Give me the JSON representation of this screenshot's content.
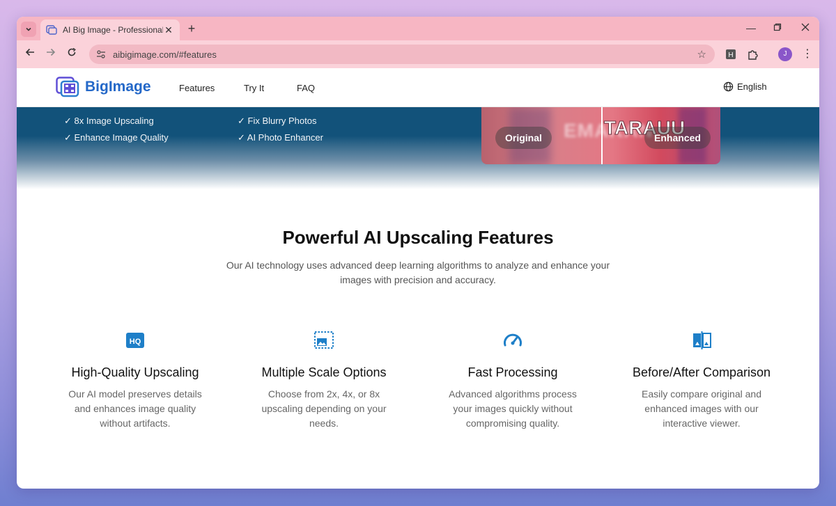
{
  "browser": {
    "tab_title": "AI Big Image - Professional Ima",
    "close_glyph": "✕",
    "new_tab_glyph": "+",
    "url": "aibigimage.com/#features",
    "extension_badge": "H",
    "profile_initial": "J",
    "icons": [
      "chevron-down-icon",
      "favicon",
      "close-icon",
      "plus-icon",
      "minimize-icon",
      "restore-icon",
      "back-icon",
      "forward-icon",
      "reload-icon",
      "site-info-icon",
      "star-icon",
      "extension-icon",
      "puzzle-icon",
      "profile-avatar",
      "kebab-menu-icon"
    ]
  },
  "site": {
    "logo_text": "BigImage",
    "nav": {
      "features": "Features",
      "try_it": "Try It",
      "faq": "FAQ"
    },
    "language": "English"
  },
  "hero": {
    "checks": [
      "✓ 8x Image Upscaling",
      "✓ Enhance Image Quality",
      "✓ Fix Blurry Photos",
      "✓ AI Photo Enhancer"
    ],
    "compare": {
      "original_label": "Original",
      "enhanced_label": "Enhanced",
      "blur_text": "EMAKAN",
      "sharp_text": "TARAUU"
    }
  },
  "features": {
    "title": "Powerful AI Upscaling Features",
    "subtitle": "Our AI technology uses advanced deep learning algorithms to analyze and enhance your images with precision and accuracy.",
    "items": [
      {
        "icon": "hq-icon",
        "title": "High-Quality Upscaling",
        "desc": "Our AI model preserves details and enhances image quality without artifacts."
      },
      {
        "icon": "image-scale-icon",
        "title": "Multiple Scale Options",
        "desc": "Choose from 2x, 4x, or 8x upscaling depending on your needs."
      },
      {
        "icon": "speedometer-icon",
        "title": "Fast Processing",
        "desc": "Advanced algorithms process your images quickly without compromising quality."
      },
      {
        "icon": "compare-icon",
        "title": "Before/After Comparison",
        "desc": "Easily compare original and enhanced images with our interactive viewer."
      }
    ]
  },
  "colors": {
    "brand": "#2468c8",
    "icon_blue": "#1e7fc8",
    "hero_dark": "#12527a",
    "tab_strip": "#f7b6c3",
    "toolbar": "#fbd2da"
  }
}
